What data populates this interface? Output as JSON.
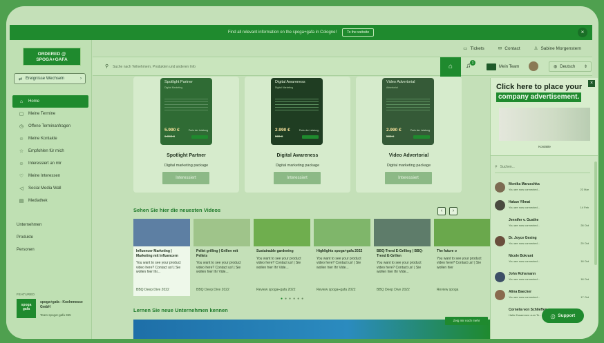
{
  "banner": {
    "text": "Find all relevant information on the spoga+gafa in Cologne!",
    "button": "To the website",
    "close": "×"
  },
  "sidebar": {
    "logo_line1": "ORDERED @",
    "logo_line2": "SPOGA+GAFA",
    "switch_label": "Ereignisse Wechseln",
    "items": [
      {
        "label": "Home",
        "icon": "⌂"
      },
      {
        "label": "Meine Termine",
        "icon": "▢"
      },
      {
        "label": "Offene Terminanfragen",
        "icon": "◷"
      },
      {
        "label": "Meine Kontakte",
        "icon": "☺"
      },
      {
        "label": "Empfohlen für mich",
        "icon": "☆"
      },
      {
        "label": "Interessiert an mir",
        "icon": "☺"
      },
      {
        "label": "Meine Interessen",
        "icon": "♡"
      },
      {
        "label": "Social Media Wall",
        "icon": "◁"
      },
      {
        "label": "Mediathek",
        "icon": "▤"
      }
    ],
    "sections": [
      "Unternehmen",
      "Produkte",
      "Personen"
    ],
    "featured_label": "FEATURED",
    "featured_logo1": "spoga",
    "featured_logo2": "gafa",
    "featured_name": "spoga+gafa - Koelnmesse GmbH",
    "featured_sub": "Team spoga+gafa 365"
  },
  "topbar": {
    "tickets": "Tickets",
    "contact": "Contact",
    "user": "Sabine Morgenstern"
  },
  "searchbar": {
    "placeholder": "Suche nach Teilnehmern, Produkten und anderen Info",
    "notif_count": "1",
    "team": "Mein Team",
    "language": "Deutsch"
  },
  "packages": [
    {
      "name": "Spotlight Partner",
      "card_title": "Spotlight Partner",
      "card_sub": "Digital Marketing",
      "desc": "Digital marketing package",
      "button": "Interessiert",
      "price": "5.990 €",
      "old_price": "6.990 €",
      "price_label": "Preis der Leistung"
    },
    {
      "name": "Digital Awareness",
      "card_title": "Digital Awareness",
      "card_sub": "Digital Marketing",
      "desc": "Digital marketing package",
      "button": "Interessiert",
      "price": "2.990 €",
      "old_price": "590 €",
      "price_label": "Preis der Leistung"
    },
    {
      "name": "Video Advertorial",
      "card_title": "Video Advertorial",
      "card_sub": "Advertorial",
      "desc": "Digital marketing package",
      "button": "Interessiert",
      "price": "2.990 €",
      "old_price": "590 €",
      "price_label": "Preis der Leistung"
    }
  ],
  "videos": {
    "title": "Sehen Sie hier die neuesten Videos",
    "prev": "‹",
    "next": "›",
    "items": [
      {
        "title": "Influencer Marketing | Marketing mit Influencern",
        "desc": "You want to see your product video here? Contact us! | Sie wollen hier Ihr...",
        "meta": "BBQ Deep Dive 2022",
        "thumb": "#5d7fa3"
      },
      {
        "title": "Pellet grilling | Grillen mit Pellets",
        "desc": "You want to see your product video here? Contact us! | Sie wollen hier Ihr Vide...",
        "meta": "BBQ Deep Dive 2022",
        "thumb": "#9fc48a"
      },
      {
        "title": "Sustainable gardening",
        "desc": "You want to see your product video here? Contact us! | Sie wollen hier Ihr Vide...",
        "meta": "Review spoga+gafa 2022",
        "thumb": "#6fae4e"
      },
      {
        "title": "Highlights spoga+gafa 2022",
        "desc": "You want to see your product video here? Contact us! | Sie wollen hier Ihr Vide...",
        "meta": "Review spoga+gafa 2022",
        "thumb": "#7fb66a"
      },
      {
        "title": "BBQ-Trend E-Grilling | BBQ-Trend E-Grillen",
        "desc": "You want to see your product video here? Contact us! | Sie wollen hier Ihr Vide...",
        "meta": "BBQ Deep Dive 2022",
        "thumb": "#5e7c6a"
      },
      {
        "title": "The future o",
        "desc": "You want to see your product video here? Contact us! | Sie wollen hier",
        "meta": "Review spoga",
        "thumb": "#6aa84c"
      }
    ]
  },
  "companies": {
    "title": "Lernen Sie neue Unternehmen kennen",
    "button": "Zeig mir noch mehr"
  },
  "ad": {
    "line1": "Click here to place your",
    "line2": "company advertisement.",
    "caption": "Kontakte"
  },
  "contacts": {
    "search_placeholder": "Suchen...",
    "items": [
      {
        "name": "Monika Maruschka",
        "msg": "You are now connected...",
        "date": "22 Mar"
      },
      {
        "name": "Hakan Yilmat",
        "msg": "You are now connected...",
        "date": "14 Feb"
      },
      {
        "name": "Jennifer v. Gusthe",
        "msg": "You are now connected...",
        "date": "28 Oct"
      },
      {
        "name": "Dr. Joyce Gesing",
        "msg": "You are now connected...",
        "date": "20 Oct"
      },
      {
        "name": "Nicole Bokrant",
        "msg": "You are now connected...",
        "date": "18 Oct"
      },
      {
        "name": "John Rohsmann",
        "msg": "You are now connected...",
        "date": "18 Oct"
      },
      {
        "name": "Alina Baecker",
        "msg": "You are now connected...",
        "date": "17 Oct"
      },
      {
        "name": "Cornelia von Schlieffen",
        "msg": "Hallo Zusammen zum Te...",
        "date": ""
      }
    ]
  },
  "support": {
    "label": "Support"
  }
}
